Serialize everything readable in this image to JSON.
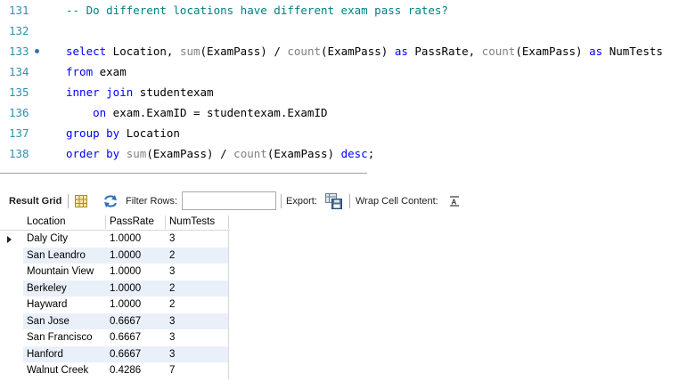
{
  "editor": {
    "lines": [
      {
        "num": "131",
        "marker": false,
        "segments": [
          {
            "t": "-- Do different locations have different exam pass rates?",
            "k": "cm"
          }
        ]
      },
      {
        "num": "132",
        "marker": false,
        "segments": []
      },
      {
        "num": "133",
        "marker": true,
        "segments": [
          {
            "t": "select",
            "k": "kw"
          },
          {
            "t": " Location, ",
            "k": "id"
          },
          {
            "t": "sum",
            "k": "fn"
          },
          {
            "t": "(ExamPass) / ",
            "k": "id"
          },
          {
            "t": "count",
            "k": "fn"
          },
          {
            "t": "(ExamPass) ",
            "k": "id"
          },
          {
            "t": "as",
            "k": "kw"
          },
          {
            "t": " PassRate, ",
            "k": "id"
          },
          {
            "t": "count",
            "k": "fn"
          },
          {
            "t": "(ExamPass) ",
            "k": "id"
          },
          {
            "t": "as",
            "k": "kw"
          },
          {
            "t": " NumTests",
            "k": "id"
          }
        ]
      },
      {
        "num": "134",
        "marker": false,
        "segments": [
          {
            "t": "from",
            "k": "kw"
          },
          {
            "t": " exam",
            "k": "id"
          }
        ]
      },
      {
        "num": "135",
        "marker": false,
        "segments": [
          {
            "t": "inner join",
            "k": "kw"
          },
          {
            "t": " studentexam",
            "k": "id"
          }
        ]
      },
      {
        "num": "136",
        "marker": false,
        "segments": [
          {
            "t": "    on",
            "k": "kw"
          },
          {
            "t": " exam.ExamID = studentexam.ExamID",
            "k": "id"
          }
        ]
      },
      {
        "num": "137",
        "marker": false,
        "segments": [
          {
            "t": "group by",
            "k": "kw"
          },
          {
            "t": " Location",
            "k": "id"
          }
        ]
      },
      {
        "num": "138",
        "marker": false,
        "segments": [
          {
            "t": "order by",
            "k": "kw"
          },
          {
            "t": " ",
            "k": "id"
          },
          {
            "t": "sum",
            "k": "fn"
          },
          {
            "t": "(ExamPass) / ",
            "k": "id"
          },
          {
            "t": "count",
            "k": "fn"
          },
          {
            "t": "(ExamPass) ",
            "k": "id"
          },
          {
            "t": "desc",
            "k": "kw"
          },
          {
            "t": ";",
            "k": "id"
          }
        ]
      }
    ]
  },
  "toolbar": {
    "result_grid_label": "Result Grid",
    "filter_label": "Filter Rows:",
    "filter_value": "",
    "export_label": "Export:",
    "wrap_label": "Wrap Cell Content:",
    "grid_icon": "grid-view-icon",
    "refresh_icon": "refresh-rows-icon",
    "export_icon": "export-save-icon",
    "wrap_icon": "wrap-text-icon"
  },
  "grid": {
    "columns": [
      "Location",
      "PassRate",
      "NumTests"
    ],
    "rows": [
      [
        "Daly City",
        "1.0000",
        "3"
      ],
      [
        "San Leandro",
        "1.0000",
        "2"
      ],
      [
        "Mountain View",
        "1.0000",
        "3"
      ],
      [
        "Berkeley",
        "1.0000",
        "2"
      ],
      [
        "Hayward",
        "1.0000",
        "2"
      ],
      [
        "San Jose",
        "0.6667",
        "3"
      ],
      [
        "San Francisco",
        "0.6667",
        "3"
      ],
      [
        "Hanford",
        "0.6667",
        "3"
      ],
      [
        "Walnut Creek",
        "0.4286",
        "7"
      ]
    ],
    "selected_row": 0,
    "alt_row_color": "#eaf0fa"
  },
  "colors": {
    "keyword": "#0000ff",
    "function": "#808080",
    "comment": "#008080",
    "line_number": "#2b91af"
  }
}
